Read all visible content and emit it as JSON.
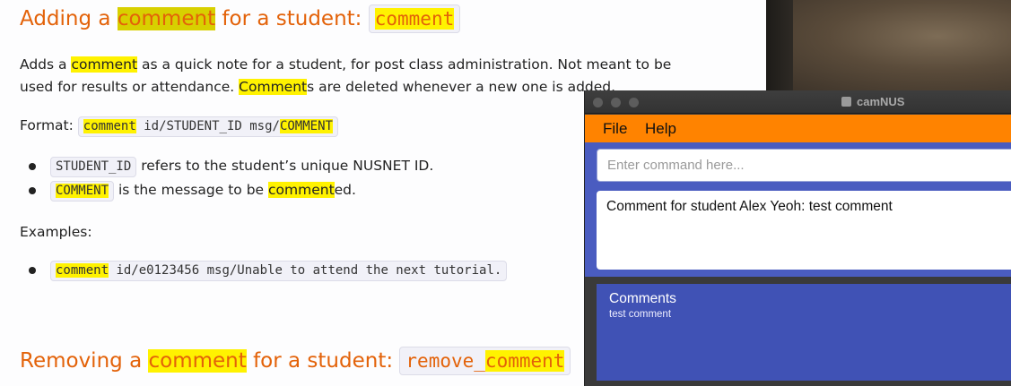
{
  "doc": {
    "heading1": {
      "prefix": "Adding a ",
      "highlight": "comment",
      "suffix": " for a student: ",
      "code": "comment"
    },
    "description": {
      "line1_pre": "Adds a ",
      "line1_hl": "comment",
      "line1_post": " as a quick note for a student, for post class administration. Not meant to be",
      "line2_pre": "used for results or attendance. ",
      "line2_hl": "Comment",
      "line2_post": "s are deleted whenever a new one is added."
    },
    "format": {
      "label": "Format: ",
      "code_hl1": "comment",
      "code_mid": " id/STUDENT_ID msg/",
      "code_hl2": "COMMENT"
    },
    "params": [
      {
        "code": "STUDENT_ID",
        "text": " refers to the student’s unique NUSNET ID."
      },
      {
        "code": "COMMENT",
        "text_pre": " is the message to be ",
        "text_hl": "comment",
        "text_post": "ed."
      }
    ],
    "examples_label": "Examples:",
    "example": {
      "code_hl": "comment",
      "code_rest": " id/e0123456 msg/Unable to attend the next tutorial."
    },
    "heading2": {
      "prefix": "Removing a ",
      "highlight": "comment",
      "suffix": " for a student: ",
      "code_pre": "remove_",
      "code_hl": "comment"
    }
  },
  "app": {
    "title": "camNUS",
    "menu": [
      "File",
      "Help"
    ],
    "command_placeholder": "Enter command here...",
    "result_text": "Comment for student Alex Yeoh: test comment",
    "comments_title": "Comments",
    "comments_text": "test comment",
    "colors": {
      "menubar": "#ff8300",
      "panel": "#4a5cc0",
      "comments_panel": "#4052b5"
    }
  }
}
